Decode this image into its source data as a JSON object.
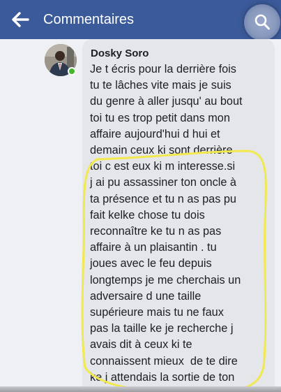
{
  "header": {
    "title": "Commentaires",
    "back_icon": "arrow-left-icon",
    "search_icon": "search-icon",
    "background_color": "#3b5a9a"
  },
  "comment": {
    "author": "Dosky Soro",
    "online_status_color": "#42b72a",
    "text": "Je t écris pour la derrière fois\ntu te lâches vite mais je suis\ndu genre à aller jusqu' au bout\ntoi tu es trop petit dans mon\naffaire aujourd'hui d hui et\ndemain ceux ki sont derrière\ntoi c est eux ki m interesse.si\nj ai pu assassiner ton oncle à\nta présence et tu n as pas pu\nfait kelke chose tu dois\nreconnaître ke tu n as pas\naffaire à un plaisantin . tu\njoues avec le feu depuis\nlongtemps je me cherchais un\nadversaire d une taille\nsupérieure mais tu ne faux\npas la taille ke je recherche j\navais dit à ceux ki te\nconnaissent mieux  de te dire\nke j attendais la sortie de ton"
  },
  "annotation": {
    "highlight_color": "#f2e94e"
  }
}
